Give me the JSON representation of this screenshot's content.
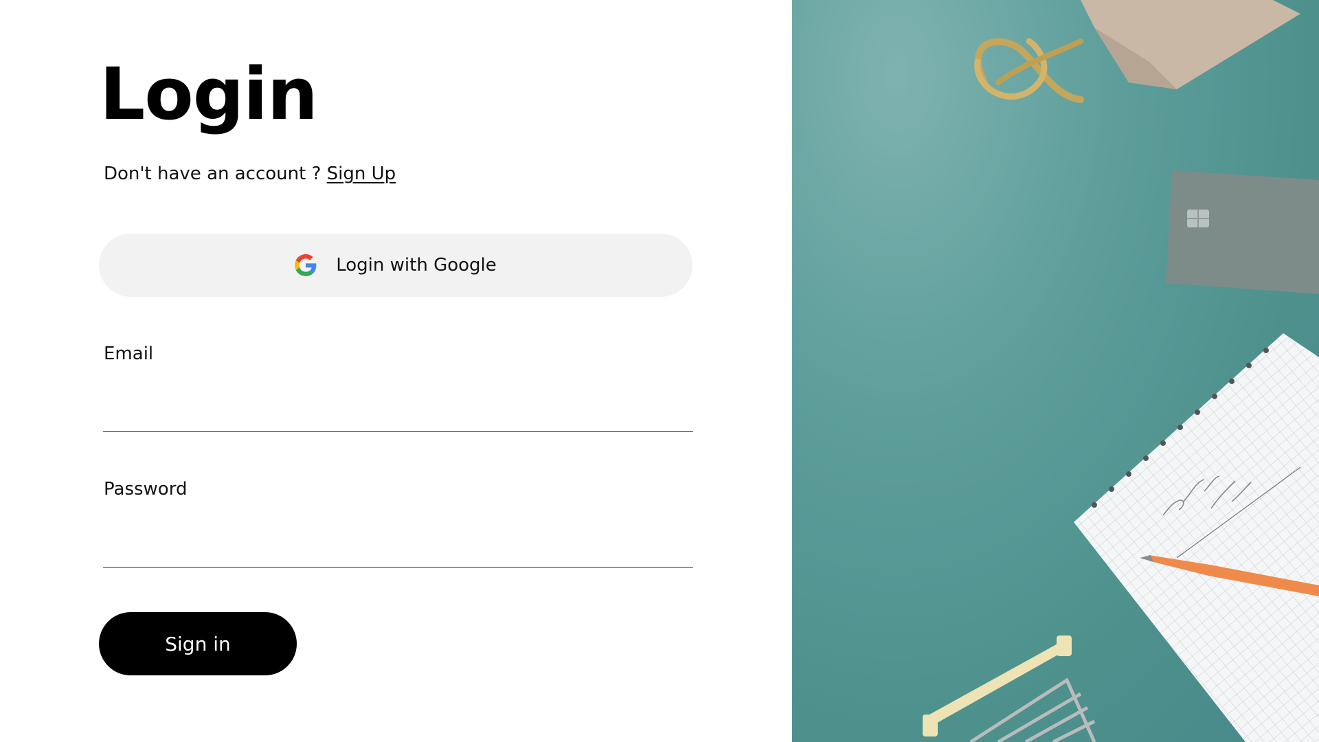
{
  "login": {
    "title": "Login",
    "signup_prompt": "Don't have an account ?",
    "signup_link": "Sign Up",
    "google_label": "Login with Google",
    "email_label": "Email",
    "email_value": "",
    "password_label": "Password",
    "password_value": "",
    "submit_label": "Sign in"
  },
  "hero": {
    "description_icons": [
      "shopping-bag",
      "credit-card",
      "notebook",
      "pencil",
      "shopping-cart"
    ],
    "background_color": "#5e9f9c"
  },
  "colors": {
    "primary_button": "#000000",
    "google_button_bg": "#f2f2f2",
    "text": "#111111",
    "google_blue": "#4285F4",
    "google_red": "#EA4335",
    "google_yellow": "#FBBC05",
    "google_green": "#34A853"
  }
}
